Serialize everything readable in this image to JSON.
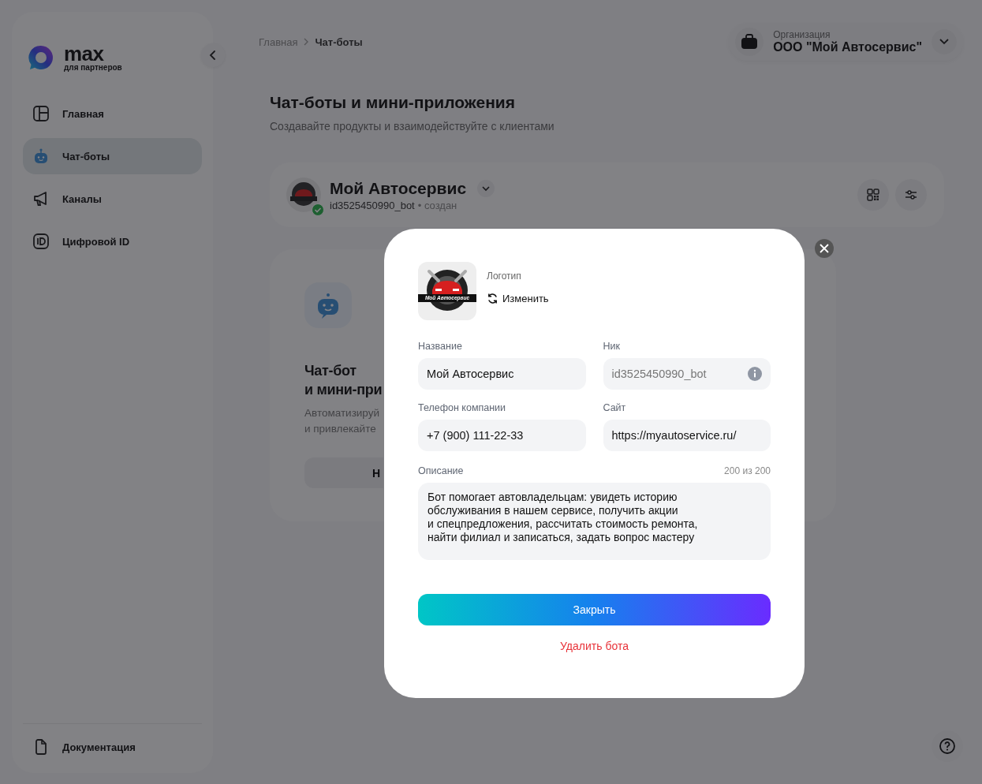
{
  "brand": {
    "name": "max",
    "tagline": "для партнеров"
  },
  "sidebar": {
    "items": [
      {
        "label": "Главная",
        "selected": false
      },
      {
        "label": "Чат-боты",
        "selected": true
      },
      {
        "label": "Каналы",
        "selected": false
      },
      {
        "label": "Цифровой ID",
        "selected": false
      }
    ],
    "footer_item": {
      "label": "Документация"
    }
  },
  "breadcrumbs": [
    {
      "label": "Главная",
      "current": false
    },
    {
      "label": "Чат-боты",
      "current": true
    }
  ],
  "organization": {
    "label": "Организация",
    "name": "ООО \"Мой Автосервис\""
  },
  "page": {
    "title": "Чат-боты и мини-приложения",
    "subtitle": "Создавайте продукты и взаимодействуйте с клиентами"
  },
  "bot_card": {
    "name": "Мой Автосервис",
    "nick": "id3525450990_bot",
    "status": "• создан",
    "verified": true
  },
  "promo_card": {
    "title_lines": [
      "Чат-бот",
      "и мини-при"
    ],
    "text_lines": [
      "Автоматизируй",
      "и привлекайте"
    ],
    "button": "Н"
  },
  "modal": {
    "logo_label": "Логотип",
    "logo_text": "Мой Автосервис",
    "change_label": "Изменить",
    "fields": [
      {
        "label": "Название",
        "value": "Мой Автосервис",
        "readonly": false,
        "info": false
      },
      {
        "label": "Ник",
        "value": "id3525450990_bot",
        "readonly": true,
        "info": true
      },
      {
        "label": "Телефон компании",
        "value": "+7 (900) 111-22-33",
        "readonly": false,
        "info": false
      },
      {
        "label": "Сайт",
        "value": "https://myautoservice.ru/",
        "readonly": false,
        "info": false
      }
    ],
    "description": {
      "label": "Описание",
      "counter": "200 из 200",
      "lines": [
        "Бот помогает автовладельцам: увидеть историю",
        "обслуживания в нашем сервисе, получить акции",
        "и спецпредложения, рассчитать стоимость ремонта,",
        "найти филиал и записаться, задать вопрос мастеру"
      ]
    },
    "primary_button": "Закрыть",
    "danger_link": "Удалить бота"
  }
}
